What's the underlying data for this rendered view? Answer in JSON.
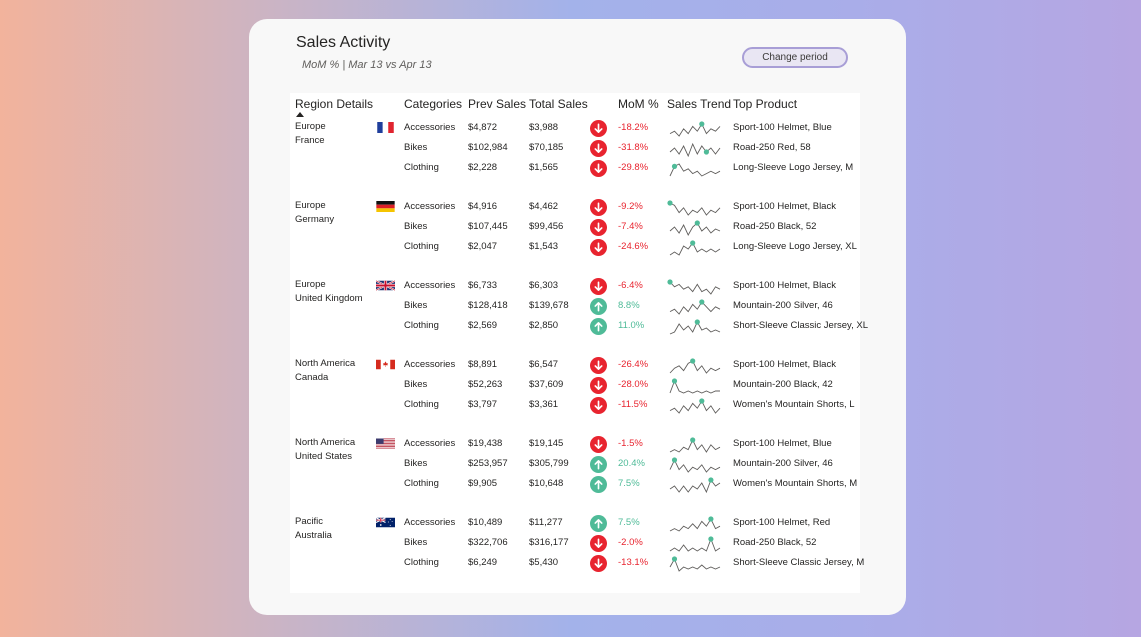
{
  "header": {
    "title": "Sales Activity",
    "subtitle": "MoM % | Mar 13 vs Apr 13",
    "change_period_label": "Change period"
  },
  "table": {
    "columns": {
      "region": "Region Details",
      "categories": "Categories",
      "prev": "Prev Sales",
      "total": "Total Sales",
      "mom": "MoM %",
      "trend": "Sales Trend",
      "top": "Top Product"
    },
    "groups": [
      {
        "continent": "Europe",
        "country": "France",
        "flag": "france-flag",
        "rows": [
          {
            "category": "Accessories",
            "prev": "$4,872",
            "total": "$3,988",
            "mom": "-18.2%",
            "direction": "down",
            "top": "Sport-100 Helmet, Blue",
            "trend": [
              5,
              6,
              4,
              7,
              5,
              8,
              6,
              9,
              5,
              7,
              6,
              8
            ],
            "marker": 7
          },
          {
            "category": "Bikes",
            "prev": "$102,984",
            "total": "$70,185",
            "mom": "-31.8%",
            "direction": "down",
            "top": "Road-250 Red, 58",
            "trend": [
              5,
              7,
              4,
              8,
              3,
              9,
              4,
              8,
              5,
              7,
              4,
              7
            ],
            "marker": 8
          },
          {
            "category": "Clothing",
            "prev": "$2,228",
            "total": "$1,565",
            "mom": "-29.8%",
            "direction": "down",
            "top": "Long-Sleeve Logo Jersey, M",
            "trend": [
              4,
              8,
              9,
              6,
              7,
              5,
              6,
              4,
              5,
              6,
              5,
              6
            ],
            "marker": 1
          }
        ]
      },
      {
        "continent": "Europe",
        "country": "Germany",
        "flag": "germany-flag",
        "rows": [
          {
            "category": "Accessories",
            "prev": "$4,916",
            "total": "$4,462",
            "mom": "-9.2%",
            "direction": "down",
            "top": "Sport-100 Helmet, Black",
            "trend": [
              9,
              8,
              5,
              7,
              4,
              6,
              5,
              7,
              4,
              6,
              5,
              7
            ],
            "marker": 0
          },
          {
            "category": "Bikes",
            "prev": "$107,445",
            "total": "$99,456",
            "mom": "-7.4%",
            "direction": "down",
            "top": "Road-250 Black, 52",
            "trend": [
              5,
              7,
              4,
              8,
              3,
              7,
              9,
              5,
              7,
              4,
              6,
              5
            ],
            "marker": 6
          },
          {
            "category": "Clothing",
            "prev": "$2,047",
            "total": "$1,543",
            "mom": "-24.6%",
            "direction": "down",
            "top": "Long-Sleeve Logo Jersey, XL",
            "trend": [
              4,
              5,
              4,
              7,
              6,
              8,
              5,
              6,
              5,
              6,
              5,
              6
            ],
            "marker": 5
          }
        ]
      },
      {
        "continent": "Europe",
        "country": "United Kingdom",
        "flag": "united-kingdom-flag",
        "rows": [
          {
            "category": "Accessories",
            "prev": "$6,733",
            "total": "$6,303",
            "mom": "-6.4%",
            "direction": "down",
            "top": "Sport-100 Helmet, Black",
            "trend": [
              9,
              7,
              8,
              6,
              7,
              5,
              8,
              5,
              6,
              4,
              7,
              6
            ],
            "marker": 0
          },
          {
            "category": "Bikes",
            "prev": "$128,418",
            "total": "$139,678",
            "mom": "8.8%",
            "direction": "up",
            "top": "Mountain-200 Silver, 46",
            "trend": [
              4,
              5,
              3,
              6,
              4,
              7,
              5,
              8,
              6,
              4,
              6,
              5
            ],
            "marker": 7
          },
          {
            "category": "Clothing",
            "prev": "$2,569",
            "total": "$2,850",
            "mom": "11.0%",
            "direction": "up",
            "top": "Short-Sleeve Classic Jersey, XL",
            "trend": [
              3,
              4,
              8,
              5,
              7,
              4,
              9,
              5,
              6,
              4,
              5,
              4
            ],
            "marker": 6
          }
        ]
      },
      {
        "continent": "North America",
        "country": "Canada",
        "flag": "canada-flag",
        "rows": [
          {
            "category": "Accessories",
            "prev": "$8,891",
            "total": "$6,547",
            "mom": "-26.4%",
            "direction": "down",
            "top": "Sport-100 Helmet, Black",
            "trend": [
              4,
              6,
              7,
              5,
              8,
              9,
              5,
              7,
              4,
              6,
              5,
              6
            ],
            "marker": 5
          },
          {
            "category": "Bikes",
            "prev": "$52,263",
            "total": "$37,609",
            "mom": "-28.0%",
            "direction": "down",
            "top": "Mountain-200 Black, 42",
            "trend": [
              3,
              9,
              4,
              3,
              4,
              3,
              4,
              3,
              4,
              3,
              4,
              4
            ],
            "marker": 1
          },
          {
            "category": "Clothing",
            "prev": "$3,797",
            "total": "$3,361",
            "mom": "-11.5%",
            "direction": "down",
            "top": "Women's Mountain Shorts, L",
            "trend": [
              5,
              6,
              4,
              7,
              5,
              8,
              6,
              9,
              5,
              7,
              4,
              6
            ],
            "marker": 7
          }
        ]
      },
      {
        "continent": "North America",
        "country": "United States",
        "flag": "united-states-flag",
        "rows": [
          {
            "category": "Accessories",
            "prev": "$19,438",
            "total": "$19,145",
            "mom": "-1.5%",
            "direction": "down",
            "top": "Sport-100 Helmet, Blue",
            "trend": [
              4,
              5,
              4,
              6,
              5,
              9,
              5,
              7,
              4,
              7,
              5,
              6
            ],
            "marker": 5
          },
          {
            "category": "Bikes",
            "prev": "$253,957",
            "total": "$305,799",
            "mom": "20.4%",
            "direction": "up",
            "top": "Mountain-200 Silver, 46",
            "trend": [
              5,
              9,
              5,
              7,
              4,
              6,
              5,
              7,
              4,
              6,
              5,
              6
            ],
            "marker": 1
          },
          {
            "category": "Clothing",
            "prev": "$9,905",
            "total": "$10,648",
            "mom": "7.5%",
            "direction": "up",
            "top": "Women's Mountain Shorts, M",
            "trend": [
              5,
              6,
              4,
              6,
              4,
              6,
              5,
              7,
              4,
              8,
              6,
              7
            ],
            "marker": 9
          }
        ]
      },
      {
        "continent": "Pacific",
        "country": "Australia",
        "flag": "australia-flag",
        "rows": [
          {
            "category": "Accessories",
            "prev": "$10,489",
            "total": "$11,277",
            "mom": "7.5%",
            "direction": "up",
            "top": "Sport-100 Helmet, Red",
            "trend": [
              4,
              5,
              4,
              6,
              5,
              7,
              5,
              8,
              6,
              9,
              5,
              6
            ],
            "marker": 9
          },
          {
            "category": "Bikes",
            "prev": "$322,706",
            "total": "$316,177",
            "mom": "-2.0%",
            "direction": "down",
            "top": "Road-250 Black, 52",
            "trend": [
              5,
              6,
              5,
              7,
              5,
              6,
              5,
              6,
              5,
              9,
              5,
              6
            ],
            "marker": 9
          },
          {
            "category": "Clothing",
            "prev": "$6,249",
            "total": "$5,430",
            "mom": "-13.1%",
            "direction": "down",
            "top": "Short-Sleeve Classic Jersey, M",
            "trend": [
              5,
              9,
              3,
              5,
              4,
              5,
              4,
              6,
              4,
              5,
              4,
              5
            ],
            "marker": 1
          }
        ]
      }
    ]
  },
  "colors": {
    "negative": "#e8242f",
    "positive": "#4fbb98",
    "sparkline": "#605e5c",
    "marker": "#4fbb98"
  }
}
